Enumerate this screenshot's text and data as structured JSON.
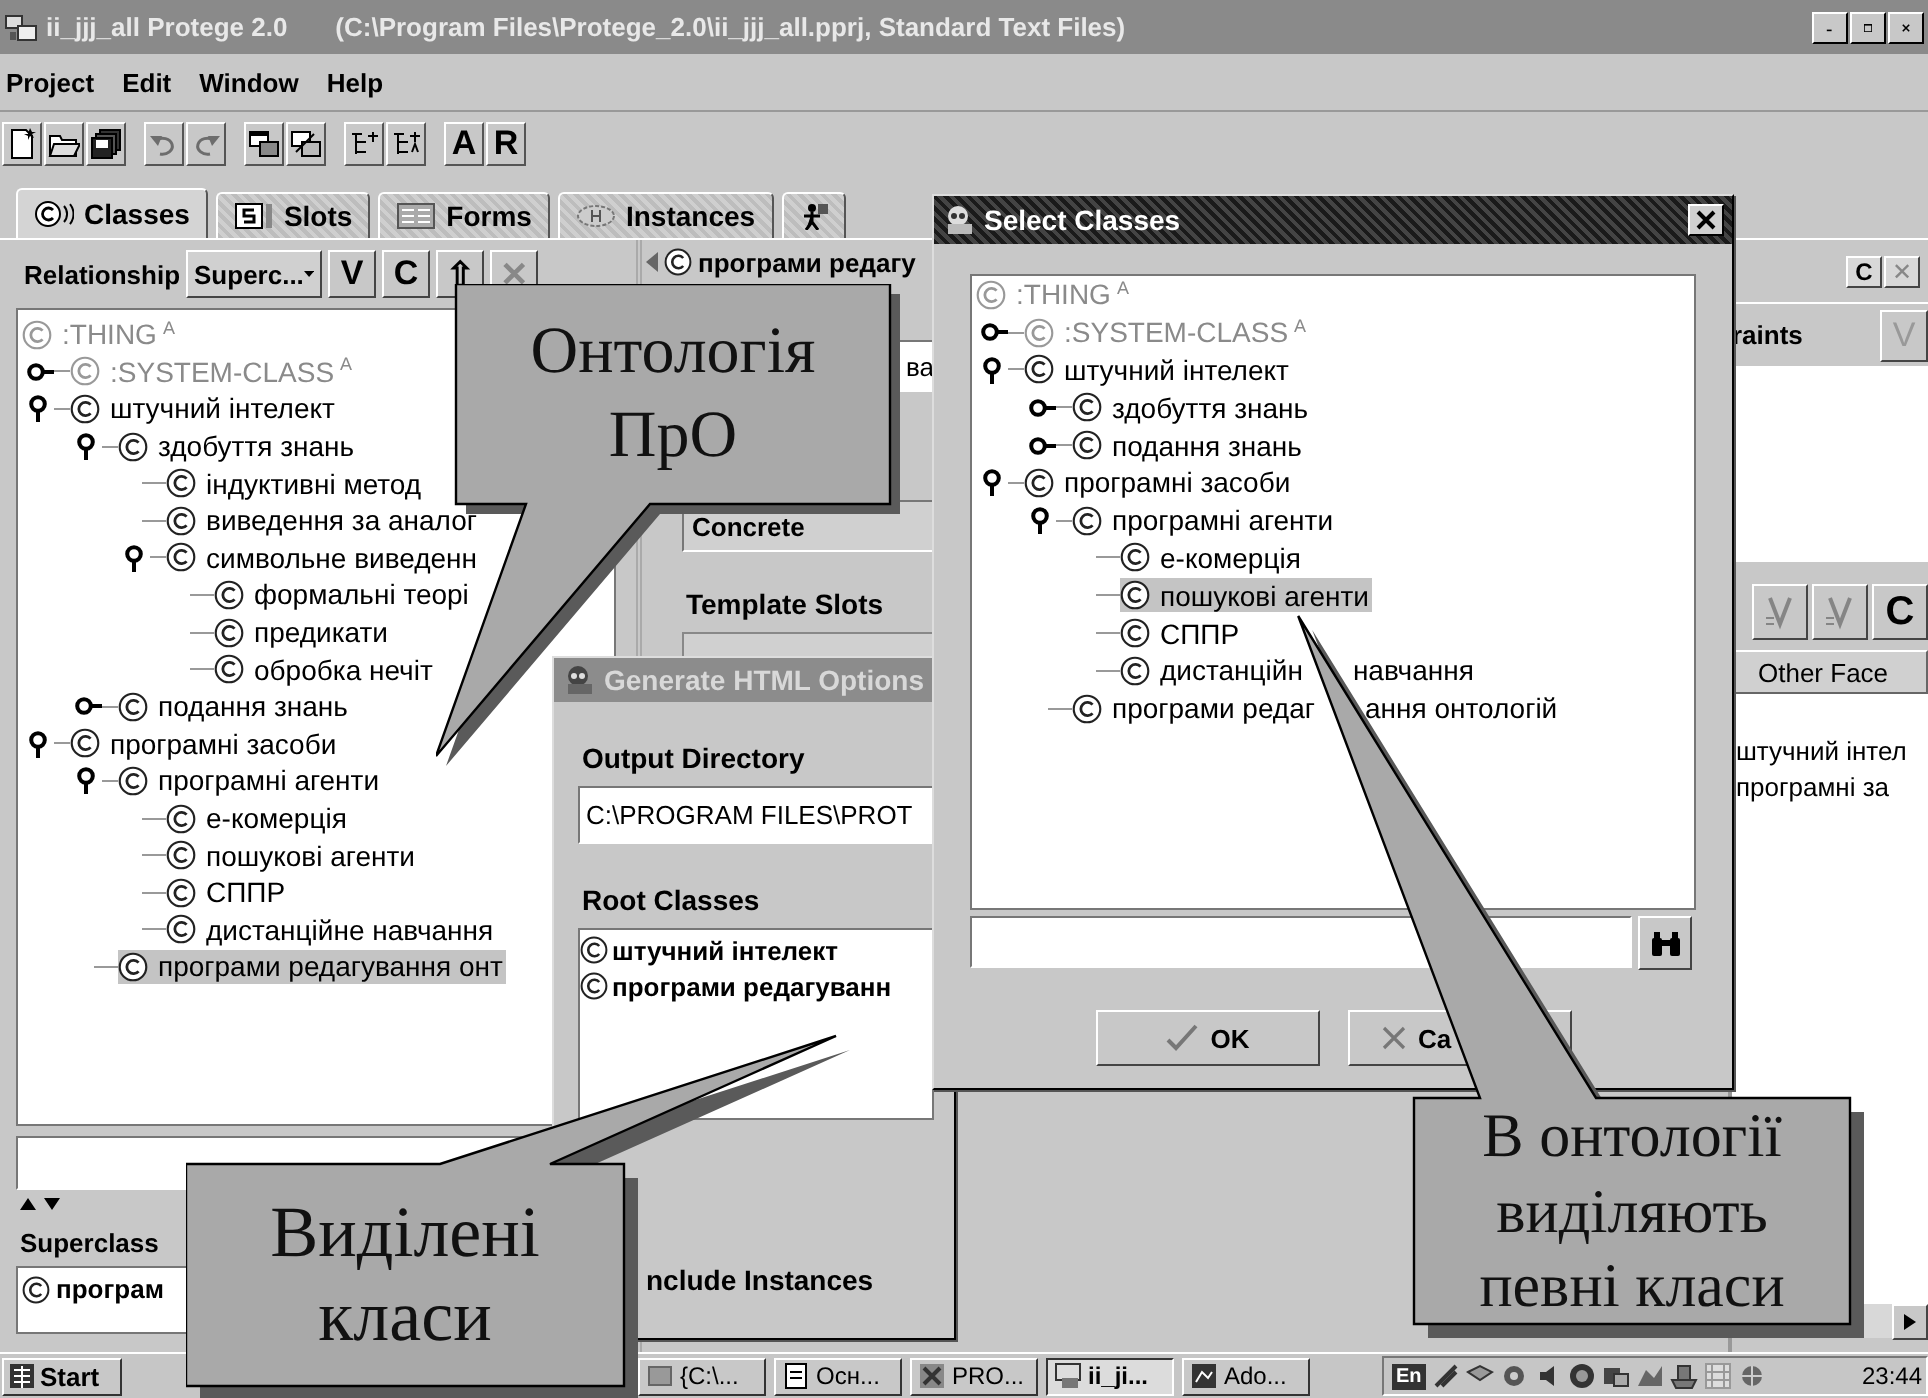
{
  "window": {
    "title": "ii_jjj_all  Protege 2.0",
    "file": "(C:\\Program Files\\Protege_2.0\\ii_jjj_all.pprj, Standard Text Files)"
  },
  "menu": [
    "Project",
    "Edit",
    "Window",
    "Help"
  ],
  "toolbar": [
    {
      "items": [
        {
          "kind": "icon",
          "disabled": false
        },
        {
          "kind": "icon",
          "disabled": false
        },
        {
          "kind": "icon",
          "disabled": false
        }
      ]
    },
    {
      "items": [
        {
          "kind": "icon",
          "disabled": true
        },
        {
          "kind": "icon",
          "disabled": true
        }
      ]
    },
    {
      "items": [
        {
          "kind": "icon",
          "disabled": false
        },
        {
          "kind": "icon",
          "disabled": false
        }
      ]
    },
    {
      "items": [
        {
          "kind": "icon",
          "disabled": false
        },
        {
          "kind": "icon",
          "disabled": false
        }
      ]
    },
    {
      "items": [
        {
          "kind": "text",
          "label": "A",
          "disabled": false
        },
        {
          "kind": "text",
          "label": "R",
          "disabled": false
        }
      ]
    }
  ],
  "tabs": [
    {
      "label": "Classes",
      "selected": true
    },
    {
      "label": "Slots",
      "selected": false
    },
    {
      "label": "Forms",
      "selected": false
    },
    {
      "label": "Instances",
      "selected": false
    },
    {
      "selected": false
    }
  ],
  "class_browser": {
    "relationship_label": "Relationship",
    "relationship_value": "Superc...",
    "buttons": [
      {
        "label": "V",
        "disabled": false
      },
      {
        "label": "C",
        "disabled": false
      },
      {
        "label": "⇧",
        "disabled": false
      },
      {
        "label": "✕",
        "disabled": true
      }
    ],
    "tree": [
      {
        "label": ":THING",
        "badge": "A",
        "greyed": true,
        "selected": false,
        "children": [
          {
            "label": ":SYSTEM-CLASS",
            "badge": "A",
            "greyed": true,
            "expanded": false,
            "selected": false
          },
          {
            "label": "штучний інтелект",
            "expanded": true,
            "selected": false,
            "children": [
              {
                "label": "здобуття знань",
                "expanded": true,
                "selected": false,
                "children": [
                  {
                    "label": "індуктивні метод",
                    "selected": false
                  },
                  {
                    "label": "виведення за аналог",
                    "selected": false
                  },
                  {
                    "label": "символьне виведенн",
                    "expanded": true,
                    "selected": false,
                    "children": [
                      {
                        "label": "формальні теорі",
                        "selected": false
                      },
                      {
                        "label": "предикати",
                        "selected": false
                      },
                      {
                        "label": "обробка нечіт",
                        "selected": false
                      }
                    ]
                  }
                ]
              },
              {
                "label": "подання знань",
                "expanded": false,
                "selected": false
              }
            ]
          },
          {
            "label": "програмні засоби",
            "expanded": true,
            "selected": false,
            "children": [
              {
                "label": "програмні агенти",
                "expanded": true,
                "selected": false,
                "children": [
                  {
                    "label": "е-комерція",
                    "selected": false
                  },
                  {
                    "label": "пошукові агенти",
                    "selected": false
                  },
                  {
                    "label": "СППР",
                    "selected": false
                  },
                  {
                    "label": "дистанційне навчання",
                    "selected": false
                  }
                ]
              },
              {
                "label": "програми редагування онт",
                "selected": true
              }
            ]
          }
        ]
      }
    ],
    "superclasses_label": "Superclass",
    "superclasses": [
      {
        "label": "програм"
      }
    ]
  },
  "class_form": {
    "header": "програми редагу",
    "name_value": "ва",
    "role_value": "Concrete",
    "template_slots_label": "Template Slots"
  },
  "facets_panel": {
    "top_buttons": [
      {
        "label": "C",
        "disabled": false
      },
      {
        "label": "✕",
        "disabled": true
      }
    ],
    "constraints_label": "raints",
    "constraints_button": {
      "label": "V",
      "disabled": true
    },
    "facet_buttons": [
      {
        "kind": "icon",
        "disabled": true
      },
      {
        "kind": "icon",
        "disabled": true
      },
      {
        "kind": "text",
        "label": "C",
        "disabled": false
      }
    ],
    "facets_header": "Other Face",
    "values": [
      "штучний інтел",
      "програмні за"
    ]
  },
  "html_dialog": {
    "title": "Generate HTML Options",
    "output_label": "Output Directory",
    "output_value": "C:\\PROGRAM FILES\\PROT",
    "roots_label": "Root Classes",
    "roots": [
      {
        "label": "штучний інтелект"
      },
      {
        "label": "програми редагуванн"
      }
    ],
    "include_label": "nclude Instances"
  },
  "select_dialog": {
    "title": "Select Classes",
    "tree": [
      {
        "label": ":THING",
        "badge": "A",
        "greyed": true,
        "selected": false,
        "children": [
          {
            "label": ":SYSTEM-CLASS",
            "badge": "A",
            "greyed": true,
            "expanded": false,
            "selected": false
          },
          {
            "label": "штучний інтелект",
            "expanded": true,
            "selected": false,
            "children": [
              {
                "label": "здобуття знань",
                "expanded": false,
                "selected": false
              },
              {
                "label": "подання знань",
                "expanded": false,
                "selected": false
              }
            ]
          },
          {
            "label": "програмні засоби",
            "expanded": true,
            "selected": false,
            "children": [
              {
                "label": "програмні агенти",
                "expanded": true,
                "selected": false,
                "children": [
                  {
                    "label": "е-комерція",
                    "selected": false
                  },
                  {
                    "label": "пошукові агенти",
                    "selected": true
                  },
                  {
                    "label": "СППР",
                    "selected": false
                  },
                  {
                    "label": "дистанційн",
                    "label_after": "навчання",
                    "selected": false
                  }
                ]
              },
              {
                "label": "програми редаг",
                "label_after": "ання онтологій",
                "selected": false
              }
            ]
          }
        ]
      }
    ],
    "ok": "OK",
    "cancel": "Ca"
  },
  "callouts": [
    {
      "lines": [
        "Онтологія",
        "ПрО"
      ]
    },
    {
      "lines": [
        "Виділені",
        "класи"
      ]
    },
    {
      "lines": [
        "В онтології",
        "виділяють",
        "певні класи"
      ]
    }
  ],
  "taskbar": {
    "start": "Start",
    "tasks": [
      {
        "label": "{C:\\...",
        "selected": false
      },
      {
        "label": "Осн...",
        "selected": false
      },
      {
        "label": "PRO...",
        "selected": false
      },
      {
        "label": "ii_ji...",
        "selected": true
      },
      {
        "label": "Ado...",
        "selected": false
      }
    ],
    "lang": "En",
    "clock": "23:44"
  }
}
